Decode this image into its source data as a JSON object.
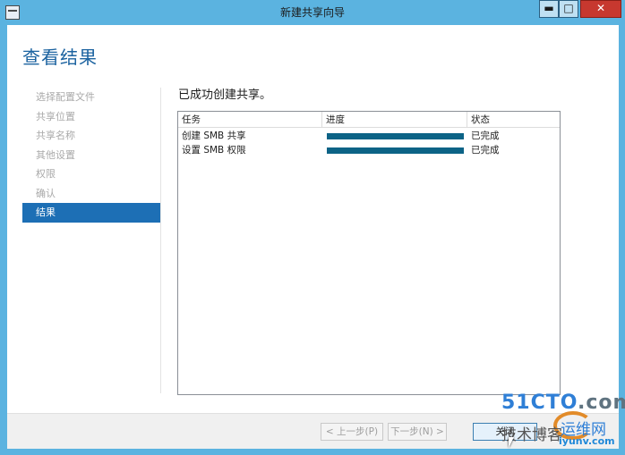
{
  "window": {
    "title": "新建共享向导",
    "controls": {
      "minimize": "▬",
      "maximize": "□",
      "close": "✕"
    }
  },
  "page": {
    "title": "查看结果"
  },
  "nav": {
    "items": [
      {
        "label": "选择配置文件",
        "active": false
      },
      {
        "label": "共享位置",
        "active": false
      },
      {
        "label": "共享名称",
        "active": false
      },
      {
        "label": "其他设置",
        "active": false
      },
      {
        "label": "权限",
        "active": false
      },
      {
        "label": "确认",
        "active": false
      },
      {
        "label": "结果",
        "active": true
      }
    ]
  },
  "results": {
    "heading": "已成功创建共享。",
    "columns": [
      "任务",
      "进度",
      "状态"
    ],
    "rows": [
      {
        "task": "创建 SMB 共享",
        "progress": 1.0,
        "status": "已完成"
      },
      {
        "task": "设置 SMB 权限",
        "progress": 1.0,
        "status": "已完成"
      }
    ]
  },
  "footer": {
    "prev_label": "< 上一步(P)",
    "next_label": "下一步(N) >",
    "close_label": "关闭"
  },
  "watermark": {
    "line1_blue": "51CTO",
    "line1_gray": ".com",
    "cn_left": "技术博客",
    "cn_right": "运维网",
    "domain": "iyunv.com"
  },
  "colors": {
    "title_blue": "#1c63a0",
    "nav_active": "#1d6fb5",
    "progress_fill": "#0c6386",
    "frame": "#5bb3e0"
  }
}
